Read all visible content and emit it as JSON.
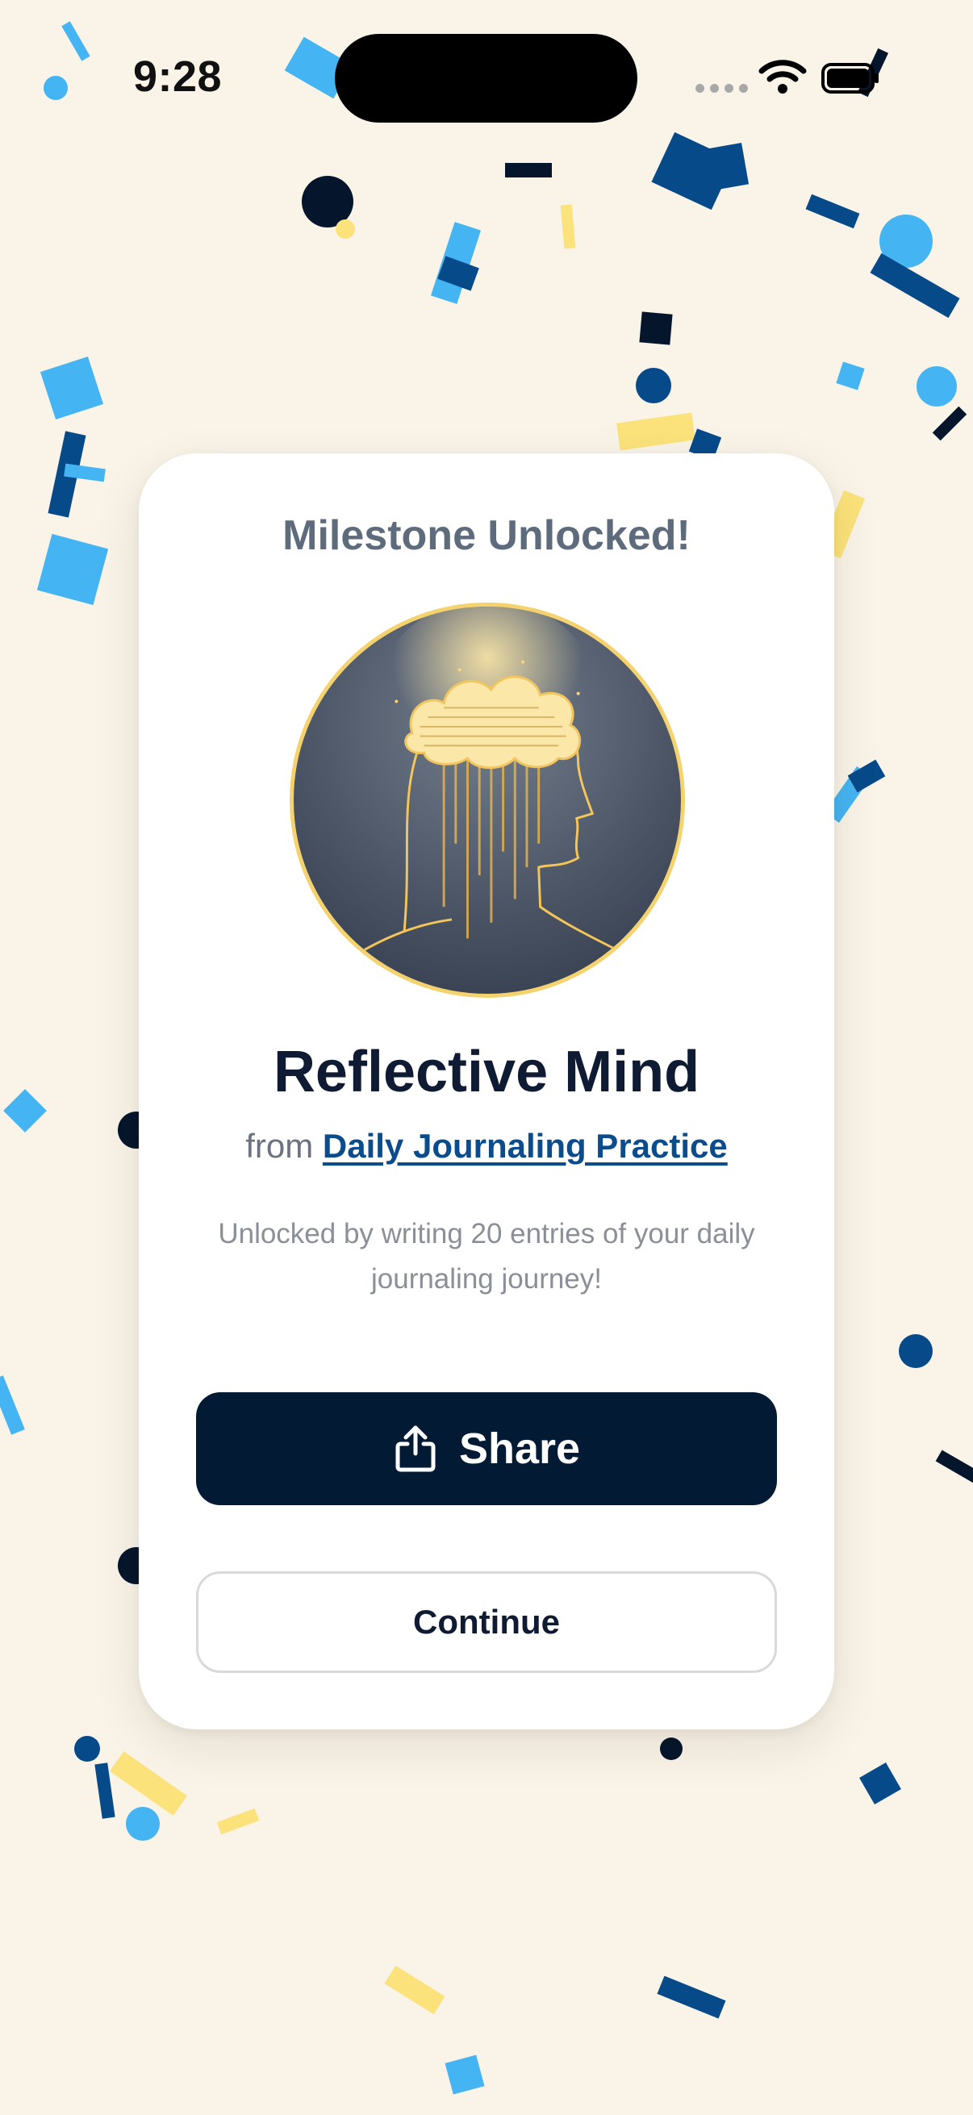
{
  "status_bar": {
    "time": "9:28"
  },
  "icons": {
    "share": "share-icon",
    "wifi": "wifi-icon",
    "battery": "battery-icon",
    "badge": "thinking-head-icon"
  },
  "colors": {
    "background": "#F9F3E8",
    "accent_dark": "#031A34",
    "link": "#0B4C8C",
    "badge_ring": "#F4D36F",
    "confetti": [
      "#45B4F2",
      "#074A8A",
      "#05152C",
      "#FBE27A"
    ]
  },
  "card": {
    "heading": "Milestone Unlocked!",
    "title": "Reflective Mind",
    "from_prefix": "from",
    "from_link": "Daily Journaling Practice",
    "description": "Unlocked by writing 20 entries of your daily journaling journey!",
    "share_label": "Share",
    "continue_label": "Continue"
  }
}
